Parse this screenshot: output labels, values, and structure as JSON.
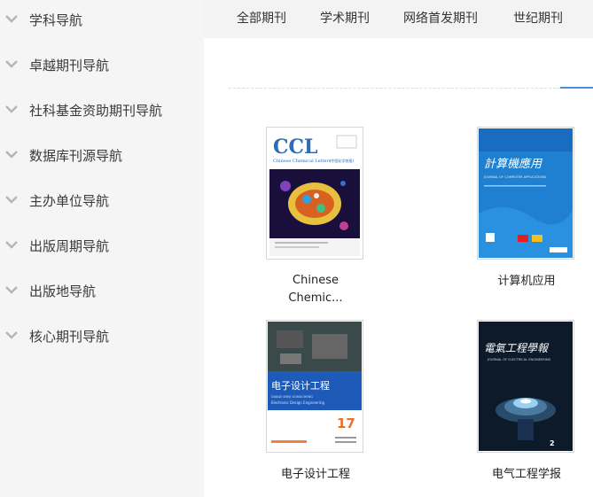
{
  "sidebar": {
    "items": [
      {
        "label": "学科导航"
      },
      {
        "label": "卓越期刊导航"
      },
      {
        "label": "社科基金资助期刊导航"
      },
      {
        "label": "数据库刊源导航"
      },
      {
        "label": "主办单位导航"
      },
      {
        "label": "出版周期导航"
      },
      {
        "label": "出版地导航"
      },
      {
        "label": "核心期刊导航"
      }
    ]
  },
  "tabs": [
    {
      "label": "全部期刊"
    },
    {
      "label": "学术期刊"
    },
    {
      "label": "网络首发期刊"
    },
    {
      "label": "世纪期刊"
    }
  ],
  "journals": [
    {
      "title_line1": "Chinese",
      "title_line2": "Chemic...",
      "cover": {
        "logo": "CCL",
        "subtitle": "Chinese Chemical Letters",
        "cn": "(中国化学快报)"
      }
    },
    {
      "title": "计算机应用",
      "cover": {
        "calligraphy": "計算機應用",
        "en": "JOURNAL OF COMPUTER APPLICATIONS"
      }
    },
    {
      "title": "电子设计工程",
      "cover": {
        "cn": "电子设计工程",
        "pinyin": "DIANZI SHEJI GONGCHENG",
        "en": "Electronic Design Engineering",
        "issue": "17"
      }
    },
    {
      "title": "电气工程学报",
      "cover": {
        "calligraphy": "電氣工程學報",
        "en": "JOURNAL OF ELECTRICAL ENGINEERING"
      }
    }
  ],
  "colors": {
    "sidebar_bg": "#f5f5f5",
    "tabbar_bg": "#f3f3f3",
    "accent": "#4a90d9",
    "edesign_blue": "#1e5bb8",
    "issue_orange": "#e8702a"
  },
  "icons": {
    "nav_chevron": "chevron-down-icon"
  }
}
